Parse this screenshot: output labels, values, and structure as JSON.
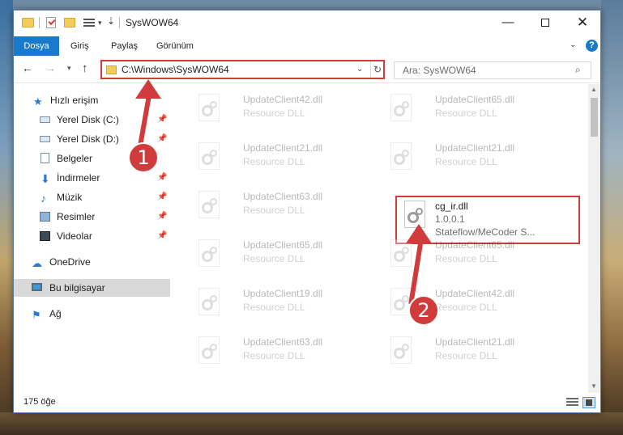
{
  "window": {
    "title": "SysWOW64"
  },
  "ribbon": {
    "tabs": [
      "Dosya",
      "Giriş",
      "Paylaş",
      "Görünüm"
    ]
  },
  "navigation": {
    "address": "C:\\Windows\\SysWOW64",
    "search_placeholder": "Ara: SysWOW64"
  },
  "sidebar": {
    "items": [
      {
        "label": "Hızlı erişim",
        "icon": "star-icon",
        "pinned": false
      },
      {
        "label": "Yerel Disk (C:)",
        "icon": "drive-icon",
        "pinned": true
      },
      {
        "label": "Yerel Disk (D:)",
        "icon": "drive-icon",
        "pinned": true
      },
      {
        "label": "Belgeler",
        "icon": "document-icon",
        "pinned": true
      },
      {
        "label": "İndirmeler",
        "icon": "download-icon",
        "pinned": true
      },
      {
        "label": "Müzik",
        "icon": "music-icon",
        "pinned": true
      },
      {
        "label": "Resimler",
        "icon": "pictures-icon",
        "pinned": true
      },
      {
        "label": "Videolar",
        "icon": "video-icon",
        "pinned": true
      },
      {
        "label": "OneDrive",
        "icon": "cloud-icon",
        "pinned": false
      },
      {
        "label": "Bu bilgisayar",
        "icon": "pc-icon",
        "pinned": false,
        "selected": true
      },
      {
        "label": "Ağ",
        "icon": "network-icon",
        "pinned": false
      }
    ]
  },
  "files": [
    {
      "name": "UpdateClient42.dll",
      "type": "Resource DLL"
    },
    {
      "name": "UpdateClient65.dll",
      "type": "Resource DLL"
    },
    {
      "name": "UpdateClient21.dll",
      "type": "Resource DLL"
    },
    {
      "name": "UpdateClient21.dll",
      "type": "Resource DLL"
    },
    {
      "name": "UpdateClient63.dll",
      "type": "Resource DLL"
    },
    {
      "name": "cg_ir.dll",
      "version": "1.0.0.1",
      "company": "Stateflow/MeCoder S...",
      "highlighted": true
    },
    {
      "name": "UpdateClient65.dll",
      "type": "Resource DLL"
    },
    {
      "name": "UpdateClient65.dll",
      "type": "Resource DLL"
    },
    {
      "name": "UpdateClient19.dll",
      "type": "Resource DLL"
    },
    {
      "name": "UpdateClient42.dll",
      "type": "Resource DLL"
    },
    {
      "name": "UpdateClient63.dll",
      "type": "Resource DLL"
    },
    {
      "name": "UpdateClient21.dll",
      "type": "Resource DLL"
    }
  ],
  "status": {
    "item_count": "175 öğe"
  },
  "annotations": {
    "step1": "1",
    "step2": "2",
    "color": "#d03c3c"
  }
}
